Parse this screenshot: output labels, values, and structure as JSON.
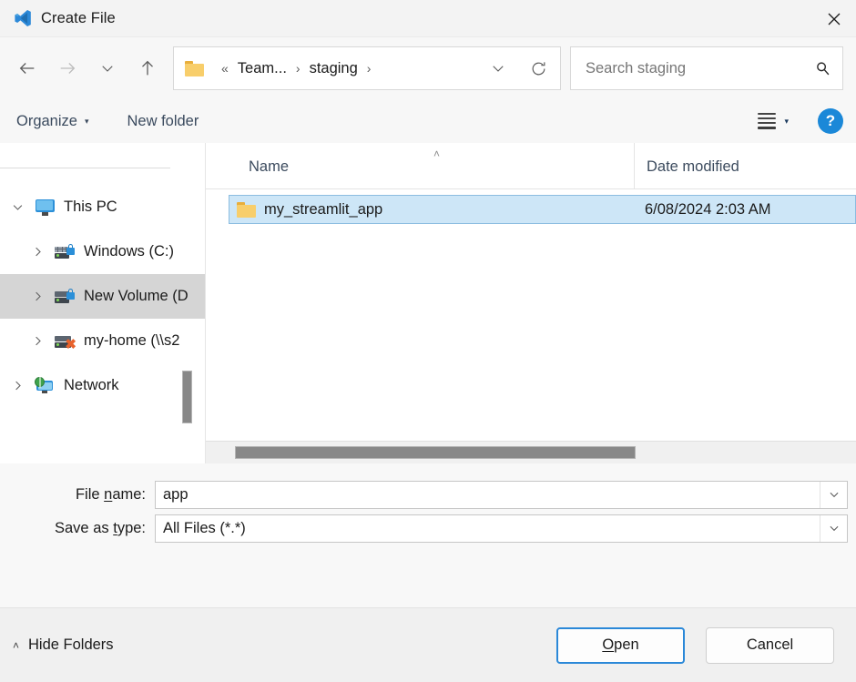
{
  "window": {
    "title": "Create File",
    "app_icon": "vscode-icon",
    "close_label": "✕"
  },
  "nav": {
    "back_icon": "arrow-left-icon",
    "forward_icon": "arrow-right-icon",
    "recent_icon": "chevron-down-icon",
    "up_icon": "arrow-up-icon",
    "breadcrumb": {
      "folder_icon": "folder-icon",
      "overflow": "«",
      "items": [
        "Team...",
        "staging"
      ],
      "separator": "›",
      "history_icon": "chevron-down-icon",
      "refresh_icon": "refresh-icon"
    },
    "search": {
      "placeholder": "Search staging",
      "value": "",
      "icon": "search-icon"
    }
  },
  "command_bar": {
    "organize_label": "Organize",
    "organize_caret": "▾",
    "new_folder_label": "New folder",
    "view_icon": "list-view-icon",
    "view_caret": "▾",
    "help_label": "?",
    "help_color": "#1b88d8"
  },
  "tree": {
    "items": [
      {
        "label": "This PC",
        "icon": "monitor-icon",
        "expander": "chevron-down-icon",
        "level": 1,
        "selected": false
      },
      {
        "label": "Windows (C:)",
        "icon": "drive-lock-icon",
        "expander": "chevron-right-icon",
        "level": 2,
        "selected": false
      },
      {
        "label": "New Volume (D",
        "icon": "drive-lock-icon",
        "expander": "chevron-right-icon",
        "level": 2,
        "selected": true
      },
      {
        "label": "my-home (\\\\s2",
        "icon": "network-drive-discon-icon",
        "expander": "chevron-right-icon",
        "level": 2,
        "selected": false
      },
      {
        "label": "Network",
        "icon": "network-globe-icon",
        "expander": "chevron-right-icon",
        "level": 1,
        "selected": false
      }
    ],
    "scrollbar": "vertical-scrollbar"
  },
  "file_list": {
    "columns": [
      {
        "key": "name",
        "label": "Name",
        "sort_caret": "˄"
      },
      {
        "key": "date",
        "label": "Date modified"
      }
    ],
    "rows": [
      {
        "icon": "folder-icon",
        "name": "my_streamlit_app",
        "date": "6/08/2024 2:03 AM",
        "selected": true
      }
    ],
    "scrollbar": "horizontal-scrollbar"
  },
  "form": {
    "file_name": {
      "label_pre": "File ",
      "label_accel": "n",
      "label_post": "ame:",
      "value": "app",
      "dropdown_icon": "chevron-down-icon"
    },
    "save_as_type": {
      "label_pre": "Save as ",
      "label_accel": "t",
      "label_post": "ype:",
      "value": "All Files (*.*)",
      "dropdown_icon": "chevron-down-icon"
    }
  },
  "footer": {
    "hide_folders_label": "Hide Folders",
    "hide_folders_caret": "˄",
    "open": {
      "pre": "",
      "accel": "O",
      "post": "pen"
    },
    "cancel_label": "Cancel",
    "focus_color": "#2b88d8"
  }
}
